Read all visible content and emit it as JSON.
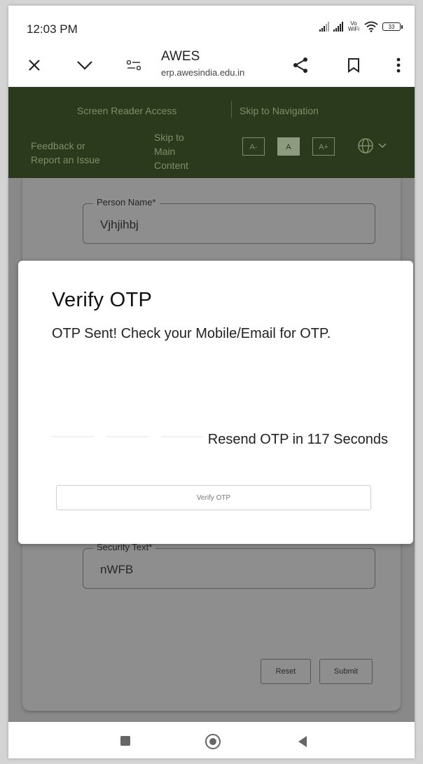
{
  "status_bar": {
    "time": "12:03 PM",
    "vowifi": "Vo WiFi",
    "battery": "33"
  },
  "browser": {
    "title": "AWES",
    "url": "erp.awesindia.edu.in",
    "icons": [
      "close-icon",
      "chevron-down-icon",
      "site-settings-icon",
      "share-icon",
      "bookmark-icon",
      "more-vert-icon"
    ]
  },
  "header": {
    "screen_reader": "Screen Reader Access",
    "skip_nav": "Skip to Navigation",
    "feedback_line1": "Feedback or",
    "feedback_line2": "Report an Issue",
    "skip_main_1": "Skip to",
    "skip_main_2": "Main",
    "skip_main_3": "Content",
    "font_smaller": "A-",
    "font_normal": "A",
    "font_larger": "A+",
    "accent": "#2b3a1c"
  },
  "form": {
    "person_name_label": "Person Name*",
    "person_name_value": "Vjhjihbj",
    "security_label": "Security Text*",
    "security_value": "nWFB",
    "reset_label": "Reset",
    "submit_label": "Submit"
  },
  "modal": {
    "title": "Verify OTP",
    "message": "OTP Sent! Check your Mobile/Email for OTP.",
    "resend": "Resend OTP in 117 Seconds",
    "verify_label": "Verify OTP"
  }
}
